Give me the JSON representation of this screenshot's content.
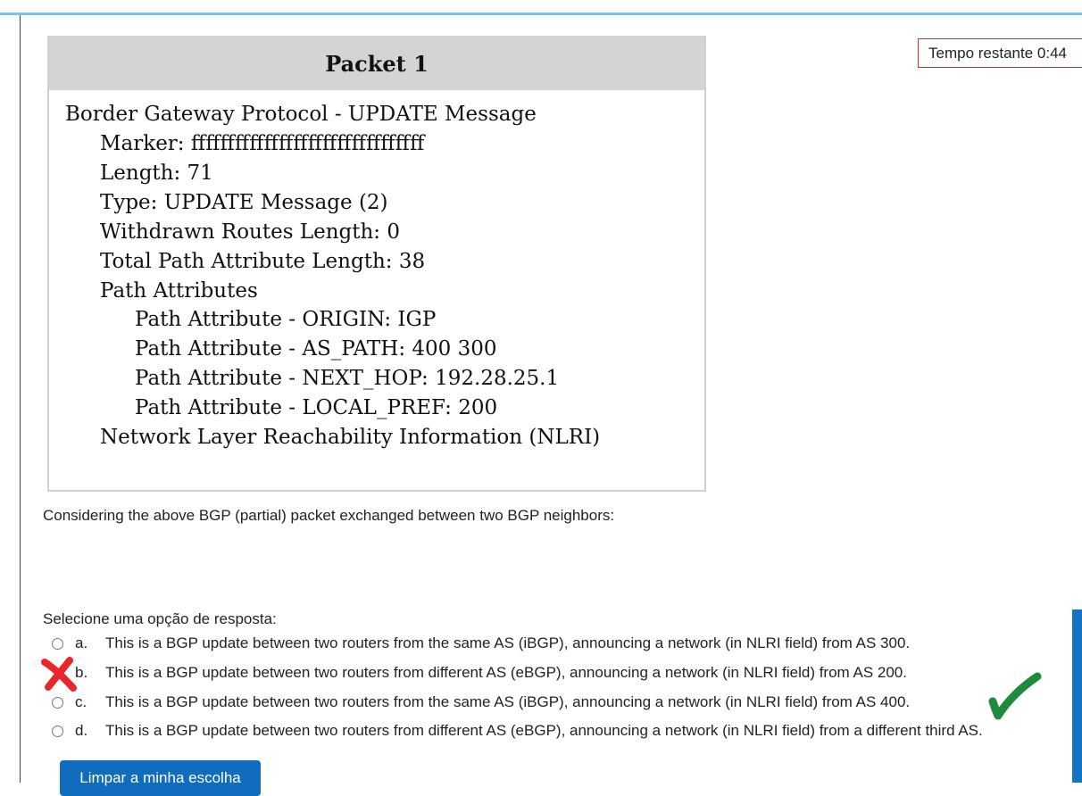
{
  "timer": {
    "text": "Tempo restante 0:44"
  },
  "packet": {
    "title": "Packet 1",
    "lines": [
      "Border Gateway Protocol - UPDATE Message",
      "Marker: ffffffffffffffffffffffffffffffff",
      "Length: 71",
      "Type: UPDATE Message (2)",
      "Withdrawn Routes Length: 0",
      "Total Path Attribute Length: 38",
      "Path Attributes",
      "Path Attribute - ORIGIN: IGP",
      "Path Attribute - AS_PATH: 400 300",
      "Path Attribute - NEXT_HOP: 192.28.25.1",
      "Path Attribute - LOCAL_PREF: 200",
      "Network Layer Reachability Information (NLRI)"
    ]
  },
  "question": {
    "text": "Considering the above BGP (partial) packet exchanged between two BGP neighbors:",
    "prompt": "Selecione uma opção de resposta:",
    "options": [
      {
        "letter": "a.",
        "text": "This is a BGP update between two routers from the same AS (iBGP), announcing a network (in NLRI field) from AS 300."
      },
      {
        "letter": "b.",
        "text": "This is a BGP update between two routers from different AS (eBGP), announcing a network (in NLRI field) from AS 200."
      },
      {
        "letter": "c.",
        "text": "This is a BGP update between two routers from the same AS (iBGP), announcing a network (in NLRI field) from AS 400."
      },
      {
        "letter": "d.",
        "text": "This is a BGP update between two routers from different AS (eBGP), announcing a network (in NLRI field) from a different third AS."
      }
    ],
    "clear_button": "Limpar a minha escolha"
  },
  "colors": {
    "accent": "#0f6cbf",
    "cross_mark": "#e8262b",
    "check_mark": "#1e8a3c",
    "top_bar": "#7cc3e8"
  },
  "icons": [
    "red-cross-mark",
    "green-check-mark"
  ]
}
